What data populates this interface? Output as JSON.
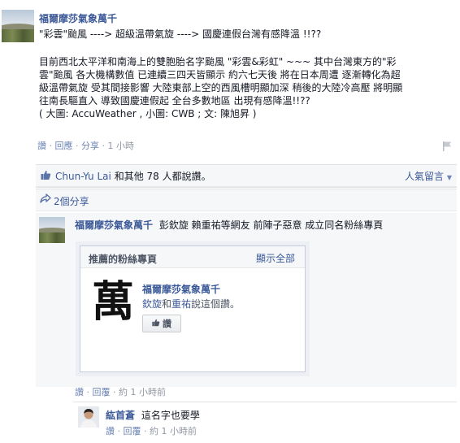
{
  "post": {
    "author": "福爾摩莎氣象萬千",
    "headline": "\"彩雲\"颱風 ----> 超級溫帶氣旋 ----> 國慶連假台灣有感降溫 !!??",
    "body_lines": [
      "目前西北太平洋和南海上的雙胞胎名字颱風 \"彩雲&彩虹\" ~~~ 其中台灣東方的\"彩",
      "雲\"颱風 各大機構數值 已連續三四天皆顯示 約六七天後 將在日本周遭 逐漸轉化為超",
      "級溫帶氣旋 受其間接影響 大陸東部上空的西風槽明顯加深 稍後的大陸冷高壓 將明顯",
      "往南長驅直入 導致國慶連假起 全台多數地區 出現有感降溫!!??",
      "( 大圖: AccuWeather , 小圖: CWB ; 文: 陳旭昇 )"
    ],
    "actions": {
      "like": "讚",
      "reply": "回應",
      "share": "分享",
      "time": "1 小時"
    }
  },
  "likes": {
    "text_name": "Chun-Yu Lai",
    "text_rest": "和其他 78 人都說讚。",
    "sort_label": "人氣留言",
    "shares": "2個分享"
  },
  "comment": {
    "author": "福爾摩莎氣象萬千",
    "text": "彭欽旋 賴重祐等網友 前陣子惡意 成立同名粉絲專頁",
    "plugin": {
      "header": "推薦的粉絲專頁",
      "show_all": "顯示全部",
      "logo_char": "萬",
      "page_name": "福爾摩莎氣象萬千",
      "friends_line_a": "欽旋",
      "friends_and": "和",
      "friends_line_b": "重祐",
      "friends_suffix": "說這個讚。",
      "like_button": "讚"
    },
    "actions": {
      "like": "讚",
      "reply": "回覆",
      "time": "約 1 小時前"
    }
  },
  "reply": {
    "author": "紘首蒼",
    "text": "這名字也要學",
    "actions": {
      "like": "讚",
      "reply": "回覆",
      "time": "約 1 小時前"
    }
  }
}
